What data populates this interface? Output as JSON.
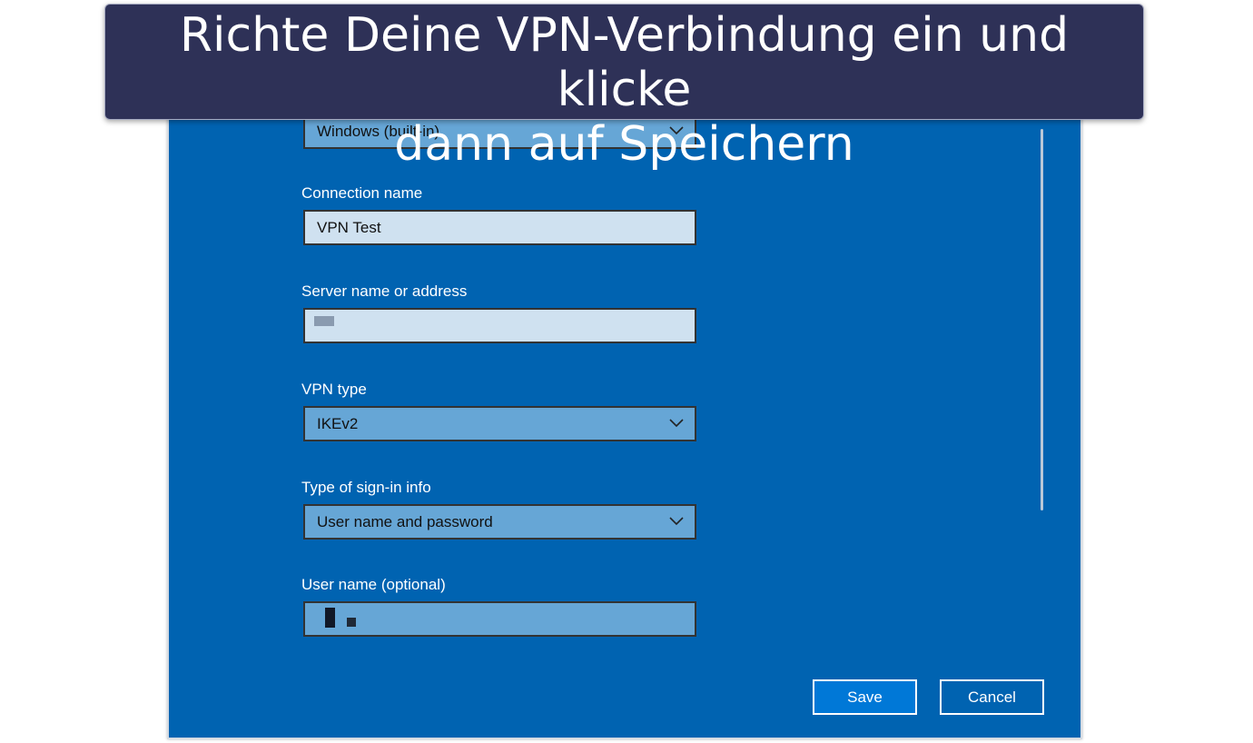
{
  "banner": {
    "line1": "Richte Deine VPN-Verbindung ein und klicke",
    "line2": "dann auf Speichern"
  },
  "form": {
    "provider_value": "Windows (built-in)",
    "connection_name_label": "Connection name",
    "connection_name_value": "VPN Test",
    "server_label": "Server name or address",
    "server_value": "",
    "vpn_type_label": "VPN type",
    "vpn_type_value": "IKEv2",
    "signin_label": "Type of sign-in info",
    "signin_value": "User name and password",
    "username_label": "User name (optional)",
    "username_value": ""
  },
  "buttons": {
    "save": "Save",
    "cancel": "Cancel"
  },
  "colors": {
    "dialog_bg": "#0063b1",
    "banner_bg": "#2e3157",
    "save_bg": "#0078d7"
  },
  "icons": {
    "dropdown": "chevron-down-icon"
  }
}
